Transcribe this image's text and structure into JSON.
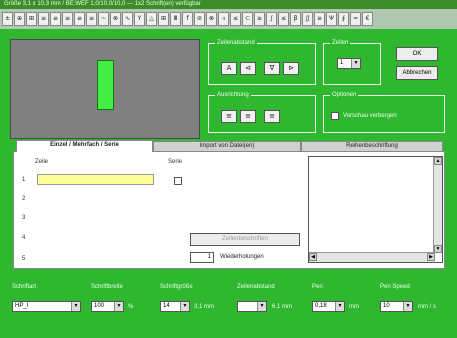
{
  "window": {
    "title": "Größe 3,1 x 10,3 mm / BE:WEF 1,0/10,0/10,0 — 1x2 Schrift(en) verfügbar"
  },
  "toolbar": {
    "buttons": [
      "±",
      "⊕",
      "⊞",
      "≡",
      "≡",
      "≡",
      "≡",
      "≡",
      "~",
      "⊗",
      "∿",
      "Y",
      "△",
      "⊞",
      "Ⅲ",
      "f",
      "⊘",
      "⊗",
      "◃",
      "≤",
      "⊂",
      "≥",
      "∫",
      "≤",
      "β",
      "∬",
      "≥",
      "Ψ",
      "∮",
      "≈",
      "€"
    ]
  },
  "ausrichtung_group": {
    "label": "Zeilenabstand",
    "buttons": [
      "A",
      "⊲",
      "∇",
      "⊳"
    ]
  },
  "zeilen_group": {
    "label": "Zeilen",
    "value": "1"
  },
  "ok_button": "OK",
  "abbrechen_button": "Abbrechen",
  "ausrichtung2_group": {
    "label": "Ausrichtung",
    "buttons": [
      "≡",
      "≡",
      "≡"
    ]
  },
  "optionen_group": {
    "label": "Optionen",
    "checkbox_label": "Vorschau verbergen"
  },
  "tabs": [
    "Einzel / Mehrfach / Serie",
    "Import von Datei(en)",
    "Reihenbeschriftung"
  ],
  "panel": {
    "col_zeile": "Zeile",
    "col_serie": "Serie",
    "row_numbers": [
      "1",
      "2",
      "3",
      "4",
      "5"
    ],
    "zeile_value": "",
    "apply_button": "Zeilenbeschriften",
    "wiederholungen_value": "1",
    "wiederholungen_label": "Wiederholungen"
  },
  "bottom": {
    "schriftart": {
      "label": "Schriftart",
      "value": "HP_I"
    },
    "schriftbreite": {
      "label": "Schriftbreite",
      "value": "100",
      "unit": "%"
    },
    "schriftgroesse": {
      "label": "Schriftgröße",
      "value": "14",
      "unit": "3,1 mm"
    },
    "zeilenabstand": {
      "label": "Zeilenabstand",
      "value": "",
      "unit": "6,1 mm"
    },
    "pen": {
      "label": "Pen",
      "value": "0,18",
      "unit": "mm"
    },
    "pen_speed": {
      "label": "Pen Speed",
      "value": "10",
      "unit": "mm / s"
    }
  }
}
